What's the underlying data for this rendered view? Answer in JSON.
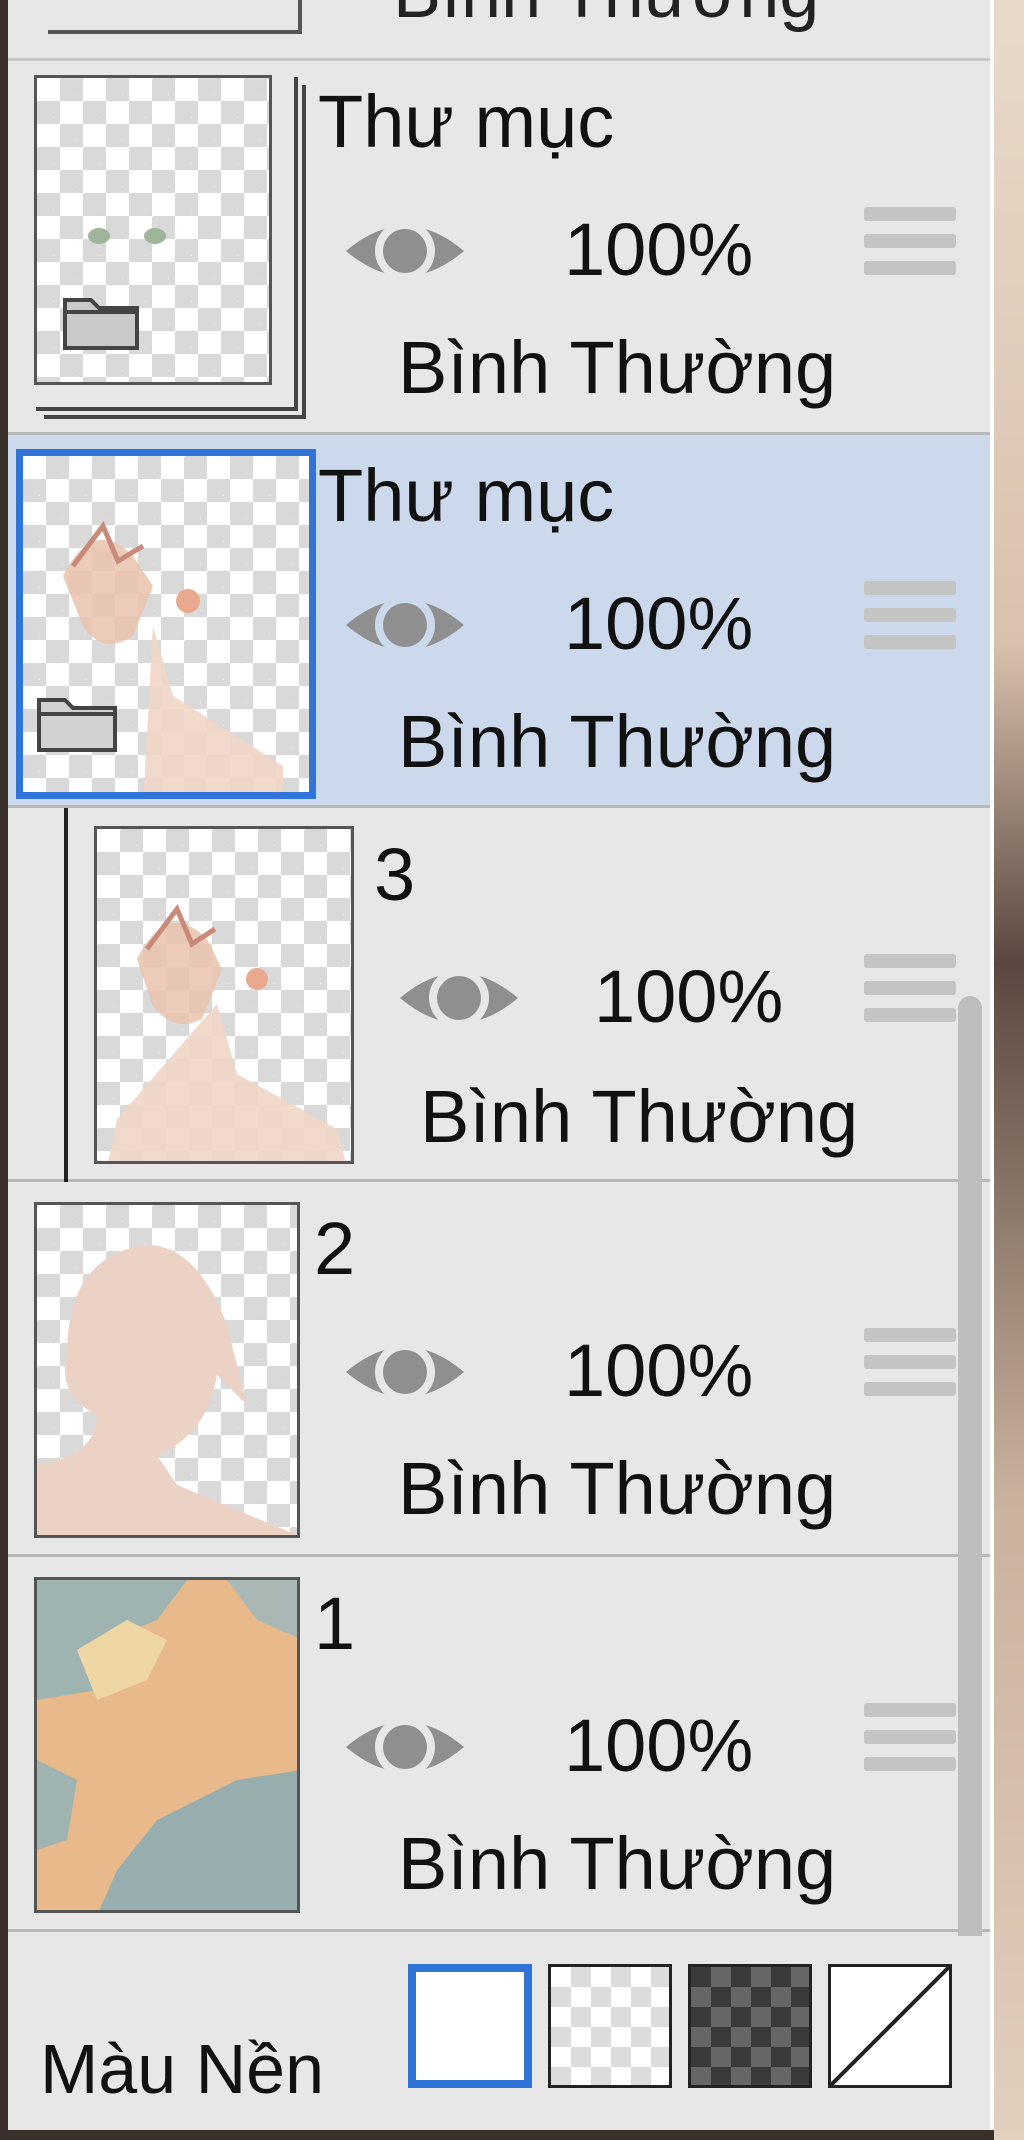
{
  "top_partial": {
    "fragment": "Bình Thường"
  },
  "layers": [
    {
      "name": "Thư mục",
      "opacity": "100%",
      "blend": "Bình Thường",
      "is_folder": true,
      "selected": false
    },
    {
      "name": "Thư mục",
      "opacity": "100%",
      "blend": "Bình Thường",
      "is_folder": true,
      "selected": true
    },
    {
      "name": "3",
      "opacity": "100%",
      "blend": "Bình Thường",
      "is_folder": false,
      "selected": false,
      "indented": true
    },
    {
      "name": "2",
      "opacity": "100%",
      "blend": "Bình Thường",
      "is_folder": false,
      "selected": false
    },
    {
      "name": "1",
      "opacity": "100%",
      "blend": "Bình Thường",
      "is_folder": false,
      "selected": false
    }
  ],
  "background": {
    "label": "Màu Nền",
    "options": [
      "white",
      "checker-light",
      "checker-dark",
      "transparent-diagonal"
    ],
    "selected": "white"
  },
  "colors": {
    "selected_row": "#ccd9ec",
    "accent": "#2f74d6",
    "panel": "#e7e7e7"
  }
}
